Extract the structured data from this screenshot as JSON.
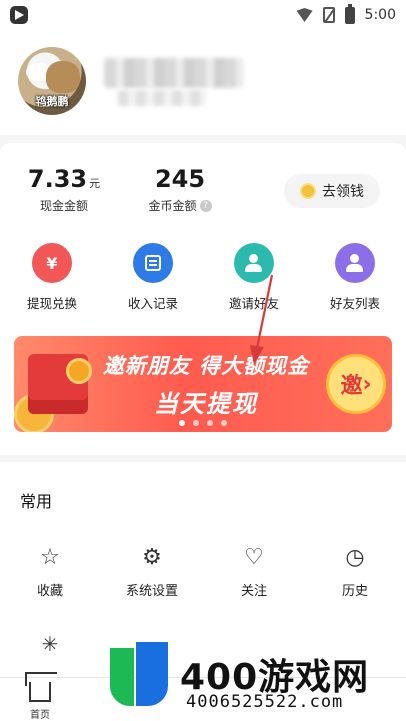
{
  "status_bar": {
    "time": "5:00",
    "icons": [
      "app-icon",
      "wifi-icon",
      "no-sim-icon",
      "battery-icon"
    ]
  },
  "profile": {
    "avatar_caption": "鸨鹅鹏"
  },
  "wallet": {
    "cash": {
      "value": "7.33",
      "unit": "元",
      "label": "现金金额"
    },
    "coin": {
      "value": "245",
      "label": "金币金额",
      "info_icon": "info-icon"
    },
    "get_money_label": "去领钱"
  },
  "actions": [
    {
      "label": "提现兑换",
      "icon": "yuan-icon",
      "glyph": "¥"
    },
    {
      "label": "收入记录",
      "icon": "document-icon"
    },
    {
      "label": "邀请好友",
      "icon": "add-user-icon"
    },
    {
      "label": "好友列表",
      "icon": "user-list-icon"
    }
  ],
  "banner": {
    "line1": "邀新朋友  得大额现金",
    "line2": "当天提现",
    "badge": "邀",
    "badge_arrow": "›",
    "pages": 4,
    "active_page": 1
  },
  "common": {
    "title": "常用",
    "items": [
      {
        "label": "收藏",
        "icon": "star-icon",
        "glyph": "☆"
      },
      {
        "label": "系统设置",
        "icon": "gear-icon",
        "glyph": "⚙"
      },
      {
        "label": "关注",
        "icon": "heart-plus-icon",
        "glyph": "♡"
      },
      {
        "label": "历史",
        "icon": "clock-icon",
        "glyph": "◷"
      }
    ]
  },
  "tabbar": {
    "home_label": "首页"
  },
  "watermark": {
    "text": "400游戏网",
    "number": "4006525522.com"
  }
}
